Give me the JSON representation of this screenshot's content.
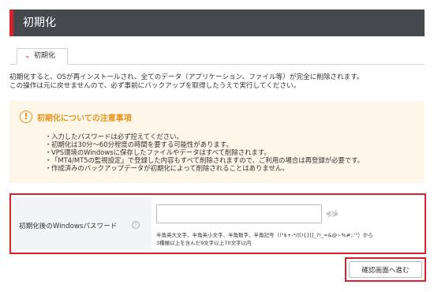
{
  "header": {
    "title": "初期化"
  },
  "tabs": [
    {
      "label": "初期化",
      "active": true
    }
  ],
  "description": {
    "line1": "初期化すると、OSが再インストールされ、全てのデータ（アプリケーション、ファイル等）が完全に削除されます。",
    "line2": "この操作は元に戻せませんので、必ず事前にバックアップを取得したうえで実行してください。"
  },
  "notice": {
    "icon": "exclamation-circle-icon",
    "title": "初期化についての注意事項",
    "items": [
      "入力したパスワードは必ず控えてください。",
      "初期化は30分〜60分程度の時間を要する可能性があります。",
      "VPS環境のWindowsに保存したファイルやデータはすべて削除されます。",
      "「MT4/MT5の監視設定」で登録した内容もすべて削除されますので、ご利用の場合は再登録が必要です。",
      "作成済みのバックアップデータが初期化によって削除されることはありません。"
    ]
  },
  "password": {
    "label": "初期化後のWindowsパスワード",
    "help_icon": "?",
    "value": "",
    "hint_line1": "半角英大文字、半角英小文字、半角数字、半角記号（!\"$+-*/|(){}[]_?!_=&@~%#;:'\"）から",
    "hint_line2": "3種類以上を含んだ9文字以上70文字以内"
  },
  "actions": {
    "confirm_label": "確認画面へ進む"
  },
  "colors": {
    "accent": "#d9202b",
    "header_bg": "#45484c",
    "notice_bg": "#fdf6e9",
    "notice_accent": "#e8941a"
  }
}
